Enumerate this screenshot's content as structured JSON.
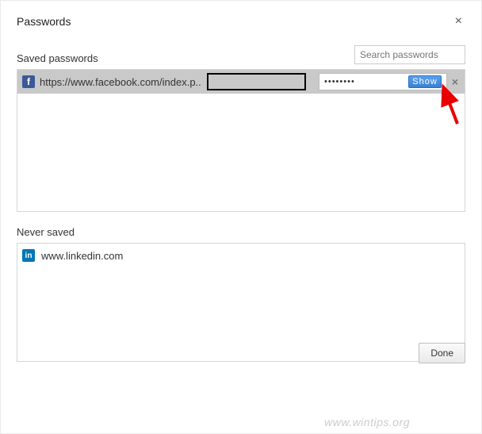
{
  "dialog": {
    "title": "Passwords",
    "close_glyph": "×"
  },
  "search": {
    "placeholder": "Search passwords"
  },
  "saved": {
    "label": "Saved passwords",
    "items": [
      {
        "icon_letter": "f",
        "icon_class": "fb",
        "url": "https://www.facebook.com/index.p..",
        "username": "",
        "password_mask": "••••••••",
        "show_label": "Show"
      }
    ]
  },
  "never": {
    "label": "Never saved",
    "items": [
      {
        "icon_letter": "in",
        "icon_class": "li",
        "url": "www.linkedin.com"
      }
    ]
  },
  "footer": {
    "done_label": "Done"
  },
  "watermark": "www.wintips.org",
  "remove_glyph": "×"
}
